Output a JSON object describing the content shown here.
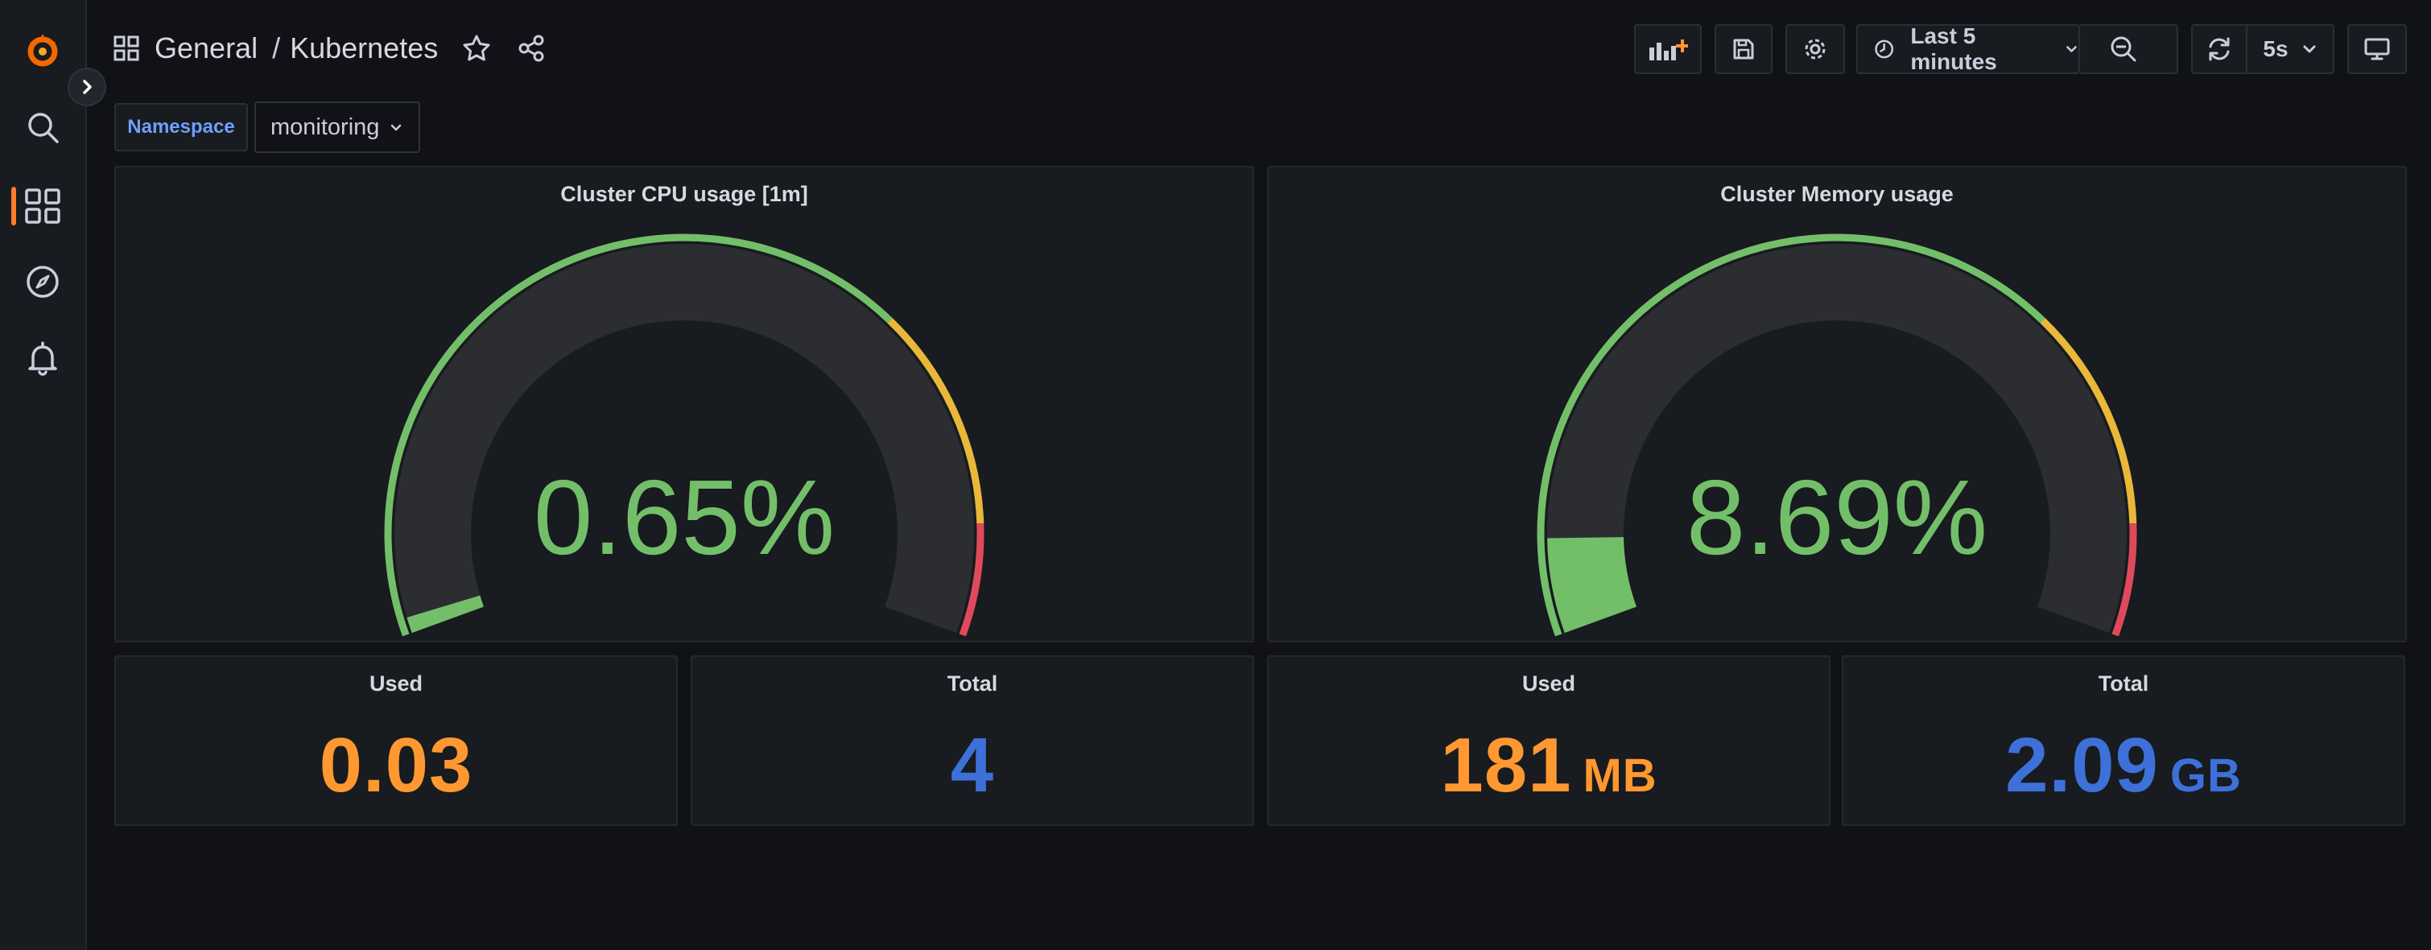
{
  "breadcrumb": {
    "folder": "General",
    "separator": "/",
    "dashboard": "Kubernetes"
  },
  "time_picker": {
    "label": "Last 5 minutes"
  },
  "refresh": {
    "interval": "5s"
  },
  "variables": {
    "namespace_label": "Namespace",
    "namespace_value": "monitoring"
  },
  "panels": {
    "cpu_gauge": {
      "title": "Cluster CPU usage [1m]",
      "value_text": "0.65%",
      "percent": 0.65
    },
    "mem_gauge": {
      "title": "Cluster Memory usage",
      "value_text": "8.69%",
      "percent": 8.69
    },
    "cpu_used": {
      "title": "Used",
      "value": "0.03"
    },
    "cpu_total": {
      "title": "Total",
      "value": "4"
    },
    "mem_used": {
      "title": "Used",
      "value": "181",
      "unit": "MB"
    },
    "mem_total": {
      "title": "Total",
      "value": "2.09",
      "unit": "GB"
    }
  },
  "gauge_thresholds": [
    {
      "from": 0,
      "to": 70,
      "color": "#73bf69"
    },
    {
      "from": 70,
      "to": 90,
      "color": "#fade2a"
    },
    {
      "from": 90,
      "to": 100,
      "color": "#f2495c"
    }
  ],
  "colors": {
    "accent": "#ff7c2a",
    "gauge_green": "#73bf69",
    "stat_orange": "#ff9830",
    "stat_blue": "#3d71d9",
    "gauge_track": "#2c2d31",
    "threshold_yellow": "#eab839",
    "threshold_red": "#e0495c"
  }
}
